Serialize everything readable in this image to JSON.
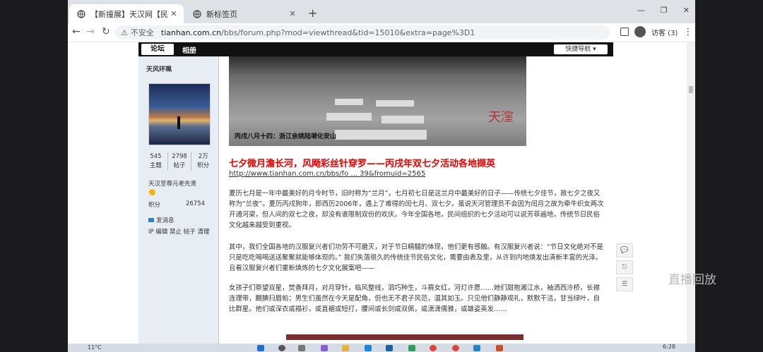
{
  "browser": {
    "tabs": [
      {
        "title": "【新撞展】天汉网【民族传统礼仪",
        "active": true
      },
      {
        "title": "新标签页",
        "active": false
      }
    ],
    "new_tab": "+",
    "window_controls": {
      "minimize": "—",
      "maximize": "❐",
      "close": "✕"
    },
    "nav": {
      "back": "←",
      "forward": "→",
      "reload": "↻"
    },
    "address": {
      "security": "不安全",
      "host": "tianhan.com.cn",
      "path": "/bbs/forum.php?mod=viewthread&tid=15010&extra=page%3D1"
    },
    "profile": {
      "label": "访客 (3)"
    },
    "menu": "⋮"
  },
  "forum": {
    "nav_logo": "论坛",
    "nav_album": "相册",
    "quick_nav": "快捷导航"
  },
  "sidebar": {
    "username": "天风环珮",
    "stats": [
      {
        "value": "545",
        "label": "主题"
      },
      {
        "value": "2798",
        "label": "帖子"
      },
      {
        "value": "2万",
        "label": "积分"
      }
    ],
    "rank": "天汉至尊元老先贤",
    "points_label": "积分",
    "points_value": "26754",
    "send_message": "发消息",
    "admin_links": "IP 编辑 禁止 帖子 清理"
  },
  "post": {
    "image_caption": "丙戌八月十四：浙江余姚陆墀化安山",
    "watermark": "天漥",
    "title": "七夕微月澹长河，风飏彩丝针穿罗——丙戌年双七夕活动各地撷英",
    "link": "http://www.tianhan.com.cn/bbs/fo ... 39&fromuid=2565",
    "paragraphs": [
      "夏历七月是一年中最美好的月令时节，旧时称为“兰月”，七月初七日是这兰月中最美好的日子——传统七夕佳节，故七夕之夜又称为“兰夜”。夏历丙戌狗年，即西历2006年，遇上了难得的闰七月、双七夕。虽说天河管理员不会因为闰月之故为牵牛织女两次开通河梁，但人间的双七之夜，却没有谁限制双份的欢庆。今年全国各地，民间组织的七夕活动可以说芳菲遍地，传统节日民俗文化越来越受到重视。",
      "其中，我们全国各地的汉服复兴者们功劳不可磨灭，对于节日精髓的体现，他们更有感触。有汉服复兴者说：“节日文化绝对不是只是吃吃喝喝送送聚聚就能够体现的。” 我们失落很久的传统佳节民俗文化，需要由表及里，从许到内地焕发出清新丰富的光泽。且看汉服复兴者们重新焕炼的七夕文化展案吧——",
      "女孩子们祭望双星，焚香拜月，对月穿针，临风整线，泗巧种生，斗赛女红，河灯许愿……她们甜抱湘江水，袖洒西泠桥，长襟连理带，靦腆扫眉帕；男生们虽然在今天是配角，但也无不君子风范，温其如玉。只见他们静静观礼，默默干活，甘当绿叶，自比群星。他们或深衣或褟衫，或直裾或短打，腰间或长剑或双佩，或潇潇儒雅，或雄姿英发……"
    ]
  },
  "float_buttons": [
    "💬",
    "⎋",
    "☰"
  ],
  "overlay": {
    "replay": "直播回放"
  },
  "taskbar": {
    "weather": "11°C",
    "time": "6:28"
  }
}
